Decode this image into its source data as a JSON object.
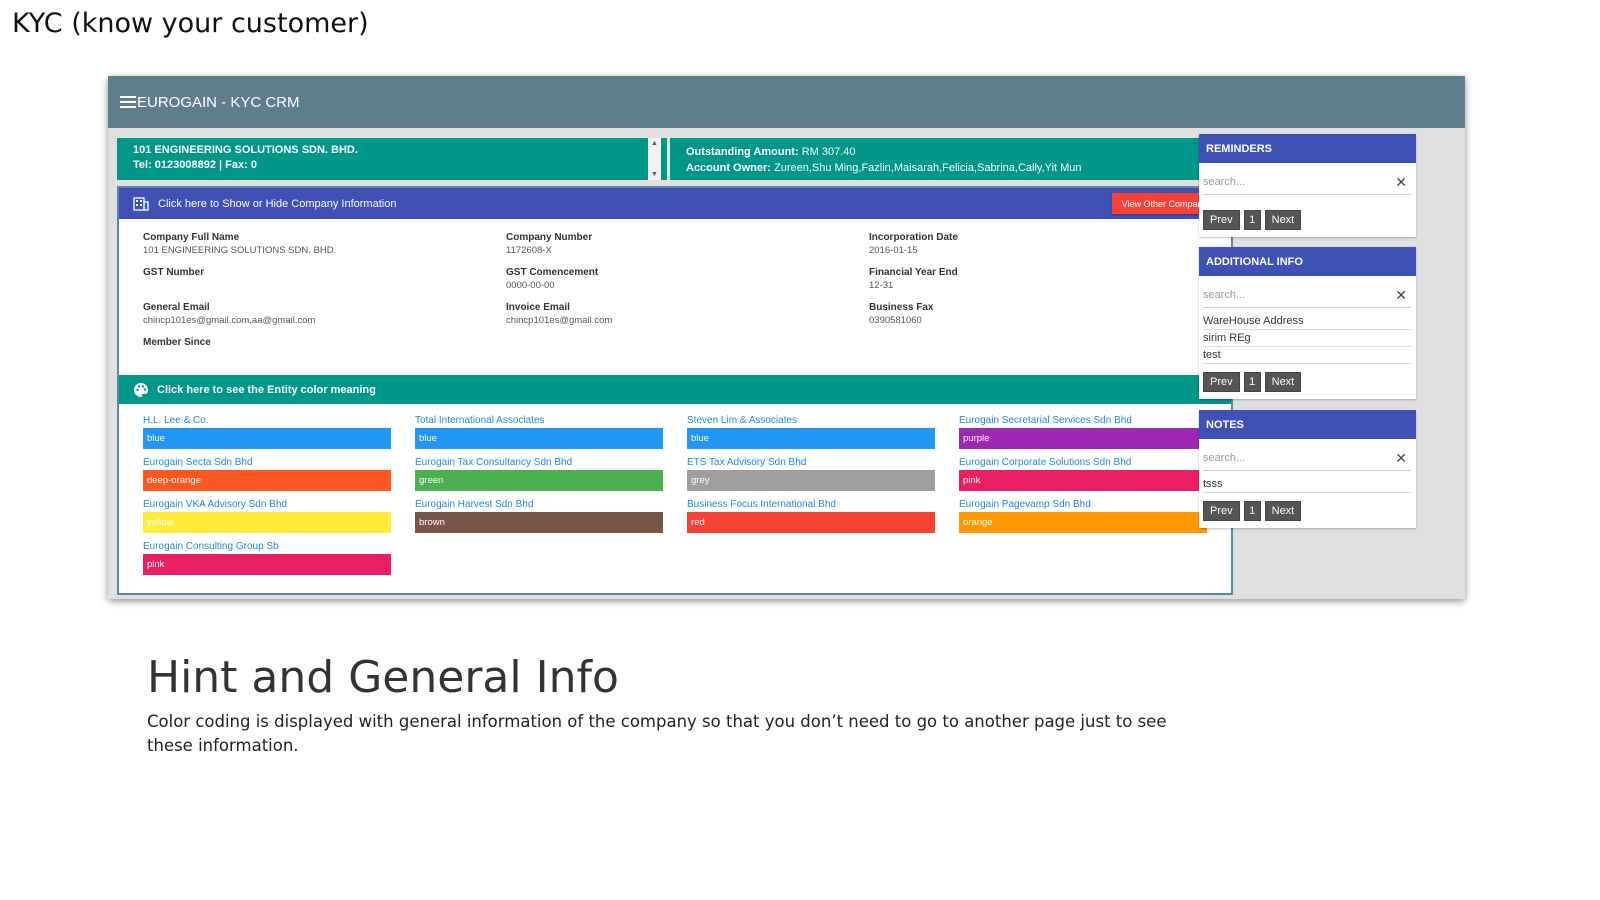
{
  "slide": {
    "title": "KYC (know your customer)",
    "hint_title": "Hint and General Info",
    "hint_text": "Color coding is displayed with general information of the company so that you don’t need to go to another page just to see these information."
  },
  "app": {
    "title": "EUROGAIN - KYC CRM",
    "company": {
      "name": "101 ENGINEERING SOLUTIONS SDN. BHD.",
      "contact": "Tel: 0123008892 | Fax: 0"
    },
    "owner": {
      "outstanding_label": "Outstanding Amount:",
      "outstanding_value": "RM 307.40",
      "owner_label": "Account Owner:",
      "owner_value": "Zureen,Shu Ming,Fazlin,Maisarah,Felicia,Sabrina,Cally,Yit Mun"
    },
    "info_bar": {
      "label": "Click here to Show or Hide Company Information",
      "view_other": "View Other Company"
    },
    "info": [
      {
        "label": "Company Full Name",
        "value": "101 ENGINEERING SOLUTIONS SDN. BHD."
      },
      {
        "label": "Company Number",
        "value": "1172608-X"
      },
      {
        "label": "Incorporation Date",
        "value": "2016-01-15"
      },
      {
        "label": "GST Number",
        "value": ""
      },
      {
        "label": "GST Comencement",
        "value": "0000-00-00"
      },
      {
        "label": "Financial Year End",
        "value": "12-31"
      },
      {
        "label": "General Email",
        "value": "chincp101es@gmail.com,aa@gmail.com"
      },
      {
        "label": "Invoice Email",
        "value": "chincp101es@gmail.com"
      },
      {
        "label": "Business Fax",
        "value": "0390581060"
      },
      {
        "label": "Member Since",
        "value": ""
      }
    ],
    "entity_bar": {
      "label": "Click here to see the Entity color meaning"
    },
    "entities": [
      {
        "name": "H.L. Lee & Co.",
        "color": "blue",
        "hex": "#2196f3"
      },
      {
        "name": "Total International Associates",
        "color": "blue",
        "hex": "#2196f3"
      },
      {
        "name": "Steven Lim & Associates",
        "color": "blue",
        "hex": "#2196f3"
      },
      {
        "name": "Eurogain Secretarial Services Sdn Bhd",
        "color": "purple",
        "hex": "#9c27b0"
      },
      {
        "name": "Eurogain Secta Sdn Bhd",
        "color": "deep-orange",
        "hex": "#ff5722"
      },
      {
        "name": "Eurogain Tax Consultancy Sdn Bhd",
        "color": "green",
        "hex": "#4caf50"
      },
      {
        "name": "ETS Tax Advisory Sdn Bhd",
        "color": "grey",
        "hex": "#9e9e9e"
      },
      {
        "name": "Eurogain Corporate Solutions Sdn Bhd",
        "color": "pink",
        "hex": "#e91e63"
      },
      {
        "name": "Eurogain VKA Advisory Sdn Bhd",
        "color": "yellow",
        "hex": "#ffeb3b"
      },
      {
        "name": "Eurogain Harvest Sdn Bhd",
        "color": "brown",
        "hex": "#795548"
      },
      {
        "name": "Business Focus International Bhd",
        "color": "red",
        "hex": "#f44336"
      },
      {
        "name": "Eurogain Pagevamp Sdn Bhd",
        "color": "orange",
        "hex": "#ff9800"
      },
      {
        "name": "Eurogain Consulting Group Sb",
        "color": "pink",
        "hex": "#e91e63"
      }
    ],
    "reminders": {
      "title": "REMINDERS",
      "search_placeholder": "search...",
      "items": [],
      "prev": "Prev",
      "page": "1",
      "next": "Next"
    },
    "additional_info": {
      "title": "ADDITIONAL INFO",
      "search_placeholder": "search...",
      "items": [
        "WareHouse Address",
        "sirim REg",
        "test"
      ],
      "prev": "Prev",
      "page": "1",
      "next": "Next"
    },
    "notes": {
      "title": "NOTES",
      "search_placeholder": "search...",
      "items": [
        "tsss"
      ],
      "prev": "Prev",
      "page": "1",
      "next": "Next"
    }
  }
}
